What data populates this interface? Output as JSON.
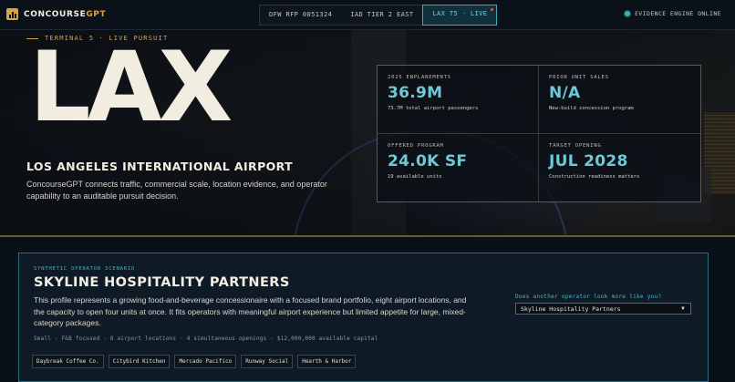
{
  "app": {
    "brand_prefix": "CONCOURSE",
    "brand_suffix": "GPT"
  },
  "tabs": [
    {
      "label": "DFW RFP 0051324",
      "active": false
    },
    {
      "label": "IAD TIER 2 EAST",
      "active": false
    },
    {
      "label": "LAX T5 · LIVE",
      "active": true
    }
  ],
  "status": {
    "label": "EVIDENCE ENGINE ONLINE"
  },
  "hero": {
    "eyebrow": "TERMINAL 5 · LIVE PURSUIT",
    "code": "LAX",
    "airport_name": "LOS ANGELES INTERNATIONAL AIRPORT",
    "description": "ConcourseGPT connects traffic, commercial scale, location evidence, and operator capability to an auditable pursuit decision."
  },
  "stats": [
    {
      "label": "2025 ENPLANEMENTS",
      "value": "36.9M",
      "sub": "73.7M total airport passengers"
    },
    {
      "label": "PRIOR UNIT SALES",
      "value": "N/A",
      "sub": "New-build concession program"
    },
    {
      "label": "OFFERED PROGRAM",
      "value": "24.0K SF",
      "sub": "19 available units"
    },
    {
      "label": "TARGET OPENING",
      "value": "JUL 2028",
      "sub": "Construction readiness matters"
    }
  ],
  "operator": {
    "eyebrow": "SYNTHETIC OPERATOR SCENARIO",
    "name": "SKYLINE HOSPITALITY PARTNERS",
    "description": "This profile represents a growing food-and-beverage concessionaire with a focused brand portfolio, eight airport locations, and the capacity to open four units at once. It fits operators with meaningful airport experience but limited appetite for large, mixed-category packages.",
    "meta": "Small · F&B focused · 8 airport locations · 4 simultaneous openings · $12,000,000 available capital",
    "brands": [
      "Daybreak Coffee Co.",
      "Citybird Kitchen",
      "Mercado Pacifico",
      "Runway Social",
      "Hearth & Harbor"
    ],
    "compare_label": "Does another operator look more like you?",
    "compare_value": "Skyline Hospitality Partners"
  },
  "colors": {
    "accent_gold": "#d9a441",
    "accent_teal": "#6fc8d4",
    "background": "#0a1018"
  }
}
